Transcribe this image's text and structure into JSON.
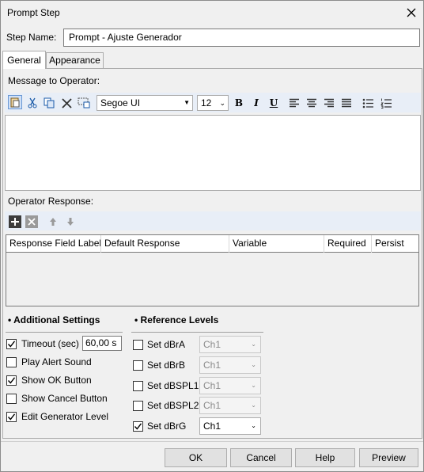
{
  "window": {
    "title": "Prompt Step"
  },
  "step_name": {
    "label": "Step Name:",
    "value": "Prompt - Ajuste Generador"
  },
  "tabs": [
    {
      "label": "General"
    },
    {
      "label": "Appearance"
    }
  ],
  "message": {
    "label": "Message to Operator:",
    "font_name": "Segoe UI",
    "font_size": "12",
    "toolbar_icons": [
      "paste-icon",
      "cut-icon",
      "copy-icon",
      "delete-icon",
      "insert-field-icon",
      "bold-icon",
      "italic-icon",
      "underline-icon",
      "align-left-icon",
      "align-center-icon",
      "align-right-icon",
      "justify-icon",
      "bullet-list-icon",
      "numbered-list-icon"
    ],
    "bold_glyph": "B",
    "italic_glyph": "I",
    "underline_glyph": "U"
  },
  "response": {
    "label": "Operator Response:",
    "columns": [
      "Response Field Label",
      "Default Response",
      "Variable",
      "Required",
      "Persist"
    ],
    "rows": []
  },
  "additional_settings": {
    "title": "Additional Settings",
    "timeout": {
      "label": "Timeout (sec)",
      "checked": true,
      "value": "60,00 s"
    },
    "items": [
      {
        "label": "Play Alert Sound",
        "checked": false
      },
      {
        "label": "Show OK Button",
        "checked": true
      },
      {
        "label": "Show Cancel Button",
        "checked": false
      },
      {
        "label": "Edit Generator Level",
        "checked": true
      }
    ]
  },
  "reference_levels": {
    "title": "Reference Levels",
    "items": [
      {
        "label": "Set dBrA",
        "checked": false,
        "channel": "Ch1",
        "enabled": false
      },
      {
        "label": "Set dBrB",
        "checked": false,
        "channel": "Ch1",
        "enabled": false
      },
      {
        "label": "Set dBSPL1",
        "checked": false,
        "channel": "Ch1",
        "enabled": false
      },
      {
        "label": "Set dBSPL2",
        "checked": false,
        "channel": "Ch1",
        "enabled": false
      },
      {
        "label": "Set dBrG",
        "checked": true,
        "channel": "Ch1",
        "enabled": true
      }
    ]
  },
  "buttons": {
    "ok": "OK",
    "cancel": "Cancel",
    "help": "Help",
    "preview": "Preview"
  },
  "colors": {
    "toolbar_bg": "#e8eef7",
    "accent": "#1a5aa8"
  }
}
